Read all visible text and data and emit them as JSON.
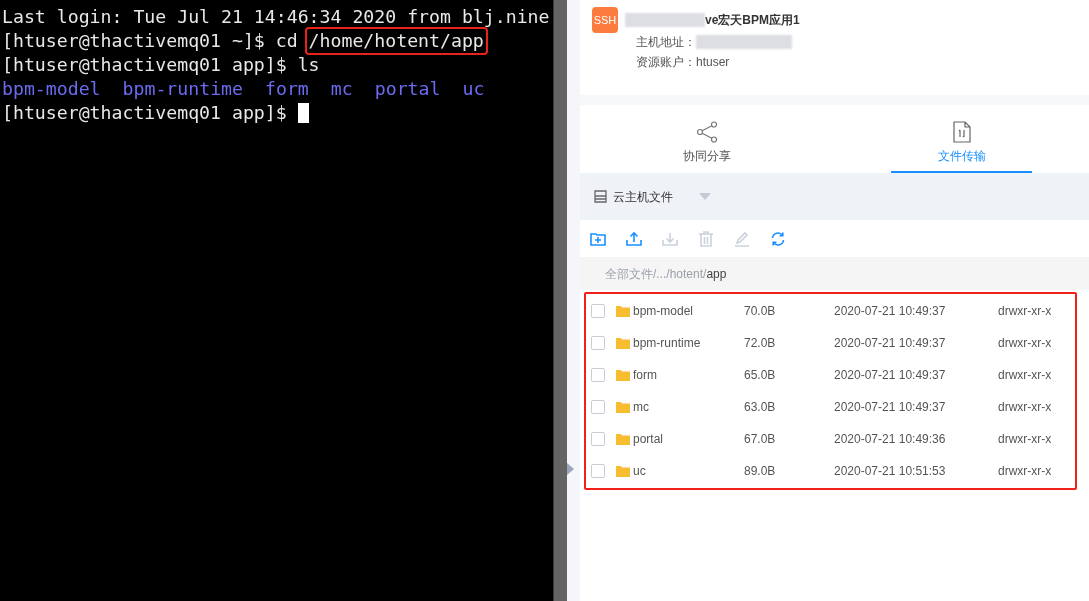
{
  "terminal": {
    "lines": [
      {
        "kind": "output",
        "text": "Last login: Tue Jul 21 14:46:34 2020 from blj.nine"
      },
      {
        "kind": "command",
        "prompt": "[htuser@thactivemq01 ~]$",
        "command": "cd",
        "argument": "/home/hotent/app",
        "highlighted": true
      },
      {
        "kind": "command",
        "prompt": "[htuser@thactivemq01 app]$",
        "command": "ls"
      },
      {
        "kind": "listing",
        "items": [
          "bpm-model",
          "bpm-runtime",
          "form",
          "mc",
          "portal",
          "uc"
        ]
      },
      {
        "kind": "prompt",
        "prompt": "[htuser@thactivemq01 app]$",
        "cursor": true
      }
    ]
  },
  "host": {
    "badge": "SSH",
    "title": "ve宏天BPM应用1",
    "title_redacted": true,
    "address_label": "主机地址：",
    "address_redacted": true,
    "account_label": "资源账户：",
    "account": "htuser"
  },
  "tabs": [
    {
      "label": "协同分享",
      "kind": "share",
      "selected": false
    },
    {
      "label": "文件传输",
      "kind": "transfer",
      "selected": true
    }
  ],
  "source": {
    "label": "云主机文件"
  },
  "toolbar": [
    {
      "kind": "new-folder",
      "disabled": false
    },
    {
      "kind": "upload",
      "disabled": false
    },
    {
      "kind": "download",
      "disabled": true
    },
    {
      "kind": "delete",
      "disabled": true
    },
    {
      "kind": "edit",
      "disabled": true
    },
    {
      "kind": "refresh",
      "disabled": false
    }
  ],
  "breadcrumb": {
    "path": "全部文件/.../hotent/",
    "current": "app"
  },
  "files": {
    "highlighted": true,
    "rows": [
      {
        "name": "bpm-model",
        "size": "70.0B",
        "modified": "2020-07-21 10:49:37",
        "permissions": "drwxr-xr-x",
        "checked": false
      },
      {
        "name": "bpm-runtime",
        "size": "72.0B",
        "modified": "2020-07-21 10:49:37",
        "permissions": "drwxr-xr-x",
        "checked": false
      },
      {
        "name": "form",
        "size": "65.0B",
        "modified": "2020-07-21 10:49:37",
        "permissions": "drwxr-xr-x",
        "checked": false
      },
      {
        "name": "mc",
        "size": "63.0B",
        "modified": "2020-07-21 10:49:37",
        "permissions": "drwxr-xr-x",
        "checked": false
      },
      {
        "name": "portal",
        "size": "67.0B",
        "modified": "2020-07-21 10:49:36",
        "permissions": "drwxr-xr-x",
        "checked": false
      },
      {
        "name": "uc",
        "size": "89.0B",
        "modified": "2020-07-21 10:51:53",
        "permissions": "drwxr-xr-x",
        "checked": false
      }
    ]
  }
}
